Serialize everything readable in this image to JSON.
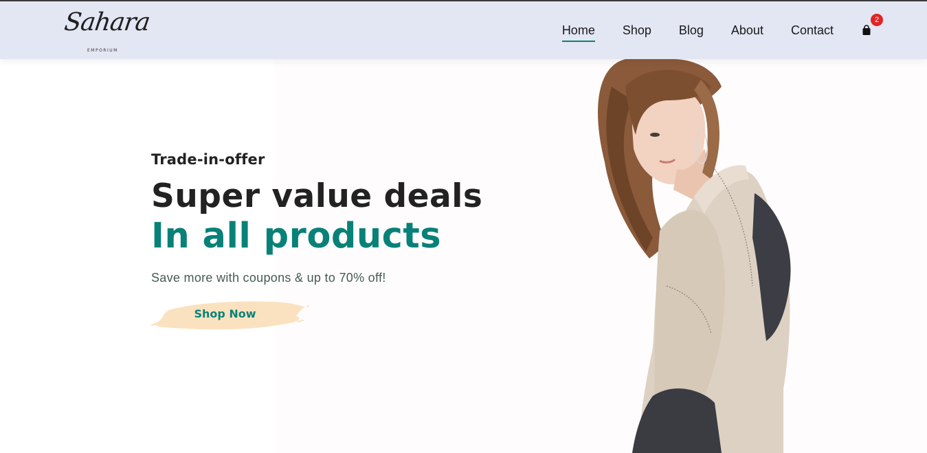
{
  "brand": {
    "name": "Sahara",
    "tagline": "EMPORIUM"
  },
  "nav": {
    "items": [
      {
        "label": "Home",
        "active": true
      },
      {
        "label": "Shop",
        "active": false
      },
      {
        "label": "Blog",
        "active": false
      },
      {
        "label": "About",
        "active": false
      },
      {
        "label": "Contact",
        "active": false
      }
    ],
    "cart": {
      "icon": "shopping-bag-icon",
      "count": "2"
    }
  },
  "hero": {
    "pretitle": "Trade-in-offer",
    "title": "Super value deals",
    "subtitle": "In all products",
    "description": "Save more with coupons & up to 70% off!",
    "button_label": "Shop Now"
  },
  "colors": {
    "header_bg": "#e3e6f3",
    "accent": "#088178",
    "button_brush": "#fae2c0",
    "badge": "#e02424",
    "text_dark": "#222222"
  }
}
